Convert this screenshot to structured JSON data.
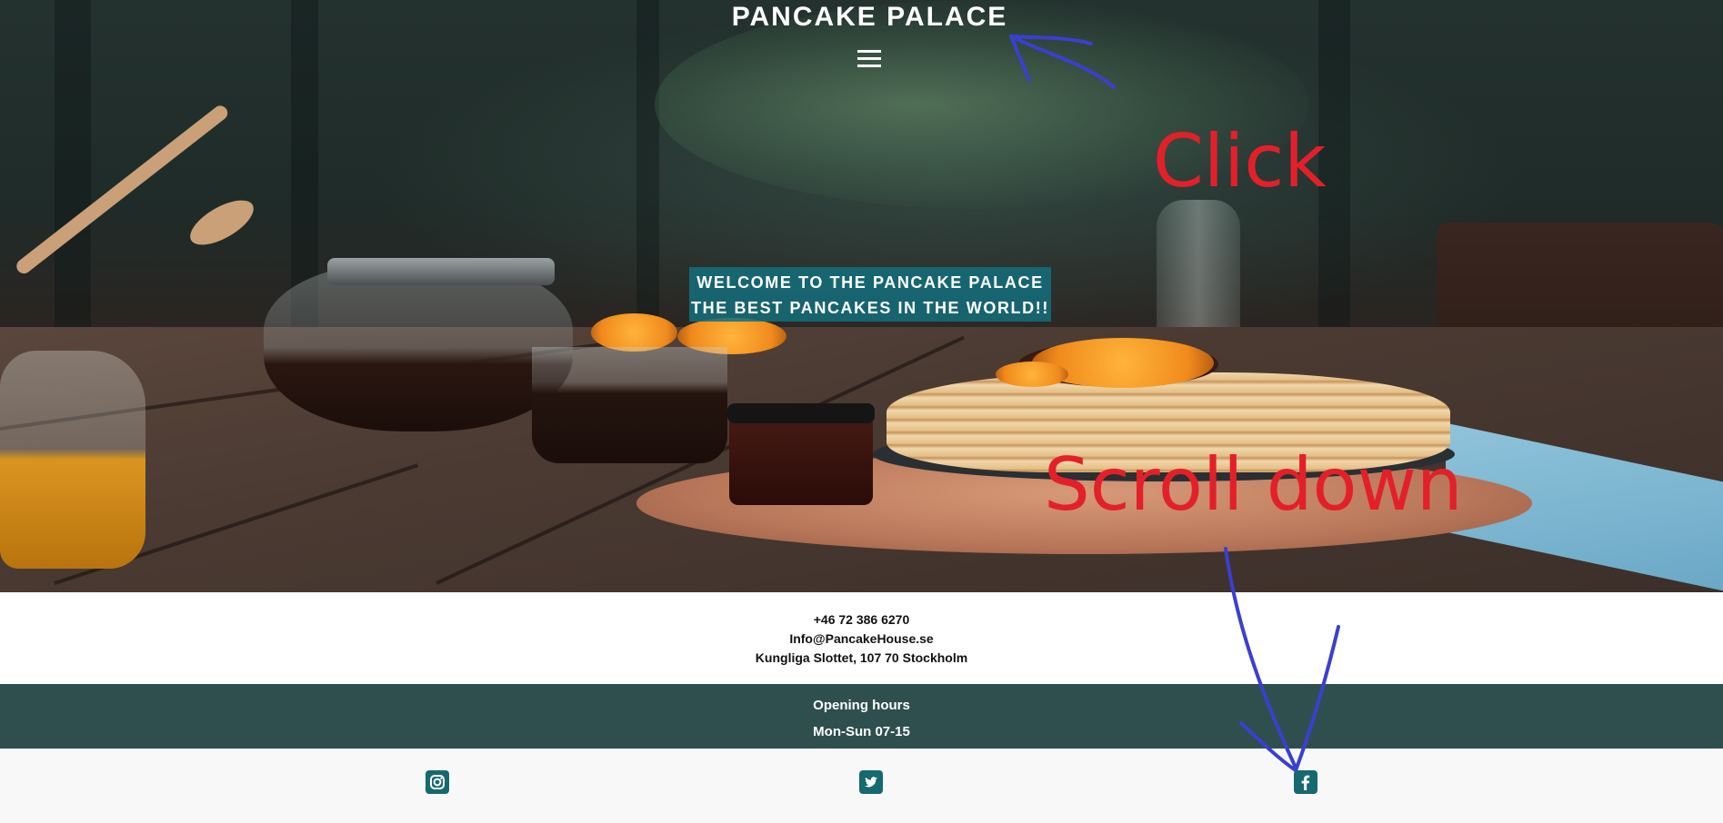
{
  "header": {
    "site_title": "PANCAKE PALACE",
    "menu_icon": "hamburger-menu-icon"
  },
  "hero": {
    "welcome_line1": "WELCOME TO THE PANCAKE PALACE",
    "welcome_line2": "THE BEST PANCAKES IN THE WORLD!!"
  },
  "contact": {
    "phone": "+46 72 386 6270",
    "email": "Info@PancakeHouse.se",
    "address": "Kungliga Slottet, 107 70 Stockholm"
  },
  "hours": {
    "title": "Opening hours",
    "schedule": "Mon-Sun 07-15"
  },
  "social": {
    "items": [
      {
        "icon": "instagram-icon"
      },
      {
        "icon": "twitter-icon"
      },
      {
        "icon": "facebook-icon"
      }
    ],
    "icon_color": "#16696e"
  },
  "annotations": {
    "click": "Click",
    "scroll": "Scroll down",
    "text_color": "#e3202a",
    "arrow_color": "#3b3fd0"
  },
  "colors": {
    "welcome_bg": "#146e7d",
    "hours_bg": "#2f4f4f",
    "footer_bg": "#f8f8f8"
  }
}
